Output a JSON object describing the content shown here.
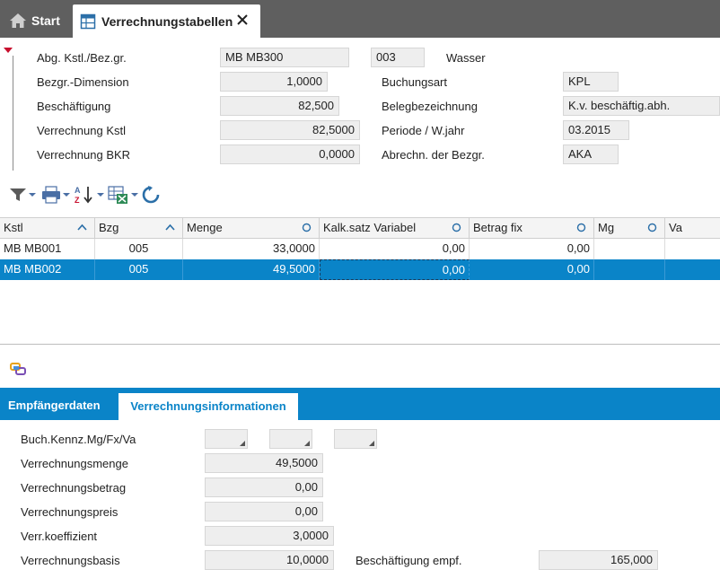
{
  "tabs": {
    "start_label": "Start",
    "active_label": "Verrechnungstabellen"
  },
  "header": {
    "abg_label": "Abg. Kstl./Bez.gr.",
    "abg_value": "MB MB300",
    "abg_code": "003",
    "abg_desc": "Wasser",
    "dimension_label": "Bezgr.-Dimension",
    "dimension_value": "1,0000",
    "buchungsart_label": "Buchungsart",
    "buchungsart_value": "KPL",
    "beschaeftigung_label": "Beschäftigung",
    "beschaeftigung_value": "82,500",
    "belegbez_label": "Belegbezeichnung",
    "belegbez_value": "K.v. beschäftig.abh.",
    "verr_kstl_label": "Verrechnung Kstl",
    "verr_kstl_value": "82,5000",
    "periode_label": "Periode / W.jahr",
    "periode_value": "03.2015",
    "verr_bkr_label": "Verrechnung BKR",
    "verr_bkr_value": "0,0000",
    "abrechn_label": "Abrechn. der Bezgr.",
    "abrechn_value": "AKA"
  },
  "grid": {
    "columns": [
      "Kstl",
      "Bzg",
      "Menge",
      "Kalk.satz Variabel",
      "Betrag fix",
      "Mg",
      "Va"
    ],
    "rows": [
      {
        "kstl": "MB MB001",
        "bzg": "005",
        "menge": "33,0000",
        "kalk": "0,00",
        "betrag": "0,00",
        "mg": "",
        "va": ""
      },
      {
        "kstl": "MB MB002",
        "bzg": "005",
        "menge": "49,5000",
        "kalk": "0,00",
        "betrag": "0,00",
        "mg": "",
        "va": ""
      }
    ],
    "selected_row": 1
  },
  "bottom": {
    "tab_empfaenger": "Empfängerdaten",
    "tab_verrechnung": "Verrechnungsinformationen",
    "buch_label": "Buch.Kennz.Mg/Fx/Va",
    "menge_label": "Verrechnungsmenge",
    "menge_value": "49,5000",
    "betrag_label": "Verrechnungsbetrag",
    "betrag_value": "0,00",
    "preis_label": "Verrechnungspreis",
    "preis_value": "0,00",
    "koeff_label": "Verr.koeffizient",
    "koeff_value": "3,0000",
    "basis_label": "Verrechnungsbasis",
    "basis_value": "10,0000",
    "besch_empf_label": "Beschäftigung empf.",
    "besch_empf_value": "165,000"
  },
  "icons": {
    "home": "home-icon",
    "table": "table-icon",
    "close": "close-icon",
    "filter": "filter-icon",
    "print": "print-icon",
    "sort": "sort-az-icon",
    "export": "excel-export-icon",
    "refresh": "refresh-icon",
    "link": "link-icon"
  },
  "colors": {
    "accent": "#0a84c8",
    "tabbar": "#5f5f5f",
    "marker": "#c8102e"
  }
}
